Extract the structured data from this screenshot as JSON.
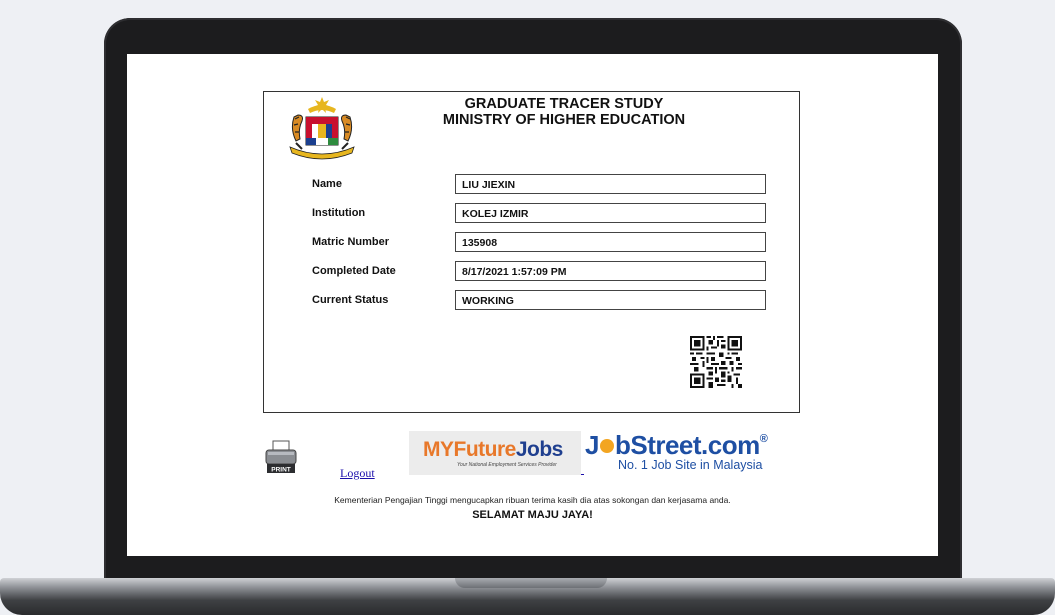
{
  "certificate": {
    "title_line1": "GRADUATE TRACER STUDY",
    "title_line2": "MINISTRY OF HIGHER EDUCATION",
    "fields": [
      {
        "label": "Name",
        "value": "LIU JIEXIN"
      },
      {
        "label": "Institution",
        "value": "KOLEJ IZMIR"
      },
      {
        "label": "Matric Number",
        "value": "135908"
      },
      {
        "label": "Completed Date",
        "value": "8/17/2021 1:57:09 PM"
      },
      {
        "label": "Current Status",
        "value": "WORKING"
      }
    ]
  },
  "actions": {
    "print_label": "PRINT",
    "logout_label": "Logout"
  },
  "partners": {
    "myfuturejobs_my": "MYFuture",
    "myfuturejobs_jobs": "Jobs",
    "myfuturejobs_tagline": "Your National Employment Services Provider",
    "jobstreet_j": "J",
    "jobstreet_rest": "bStreet.com",
    "jobstreet_reg": "®",
    "jobstreet_tagline": "No. 1 Job Site in Malaysia"
  },
  "footer": {
    "thanks": "Kementerian Pengajian Tinggi mengucapkan ribuan terima kasih dia atas sokongan dan kerjasama anda.",
    "slogan": "SELAMAT MAJU JAYA!"
  },
  "colors": {
    "myfuture_orange": "#e8782a",
    "myfuture_blue": "#1f3f8f",
    "jobstreet_blue": "#1e4fa3",
    "jobstreet_dot": "#f3a521",
    "link": "#1a0dab"
  },
  "icons": {
    "crest": "malaysia-coat-of-arms",
    "qr": "qr-code-icon",
    "print": "printer-icon"
  }
}
